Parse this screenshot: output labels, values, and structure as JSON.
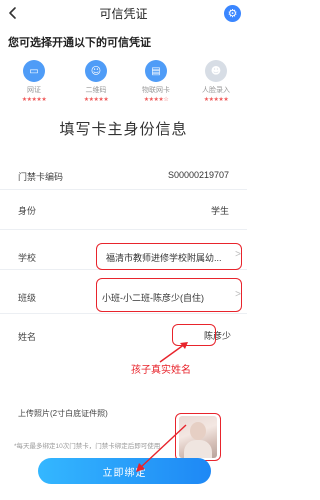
{
  "header": {
    "title": "可信凭证"
  },
  "subtitle": "您可选择开通以下的可信凭证",
  "options": [
    {
      "label": "网证",
      "stars": "★★★★★",
      "icon": "id-card-icon",
      "active": true
    },
    {
      "label": "二维码",
      "stars": "★★★★★",
      "icon": "user-icon",
      "active": true
    },
    {
      "label": "物联网卡",
      "stars": "★★★★☆",
      "icon": "card-icon",
      "active": true
    },
    {
      "label": "人脸录入",
      "stars": "★★★★★",
      "icon": "face-icon",
      "active": false
    }
  ],
  "form": {
    "title": "填写卡主身份信息",
    "card_no_label": "门禁卡编码",
    "card_no": "S00000219707",
    "identity_label": "身份",
    "identity": "学生",
    "school_label": "学校",
    "school": "福清市教师进修学校附属幼...",
    "class_label": "班级",
    "class": "小班-小二班-陈彦少(自住)",
    "name_label": "姓名",
    "name": "陈彦少",
    "photo_label": "上传照片(2寸白底证件照)"
  },
  "annotation": {
    "hint": "孩子真实姓名"
  },
  "note": "*每天最多绑定10次门禁卡，门禁卡绑定后即可使用",
  "submit_label": "立即绑定",
  "colors": {
    "accent": "#3a86ff",
    "annotation": "#e8242c",
    "button": "#1e88f5"
  }
}
